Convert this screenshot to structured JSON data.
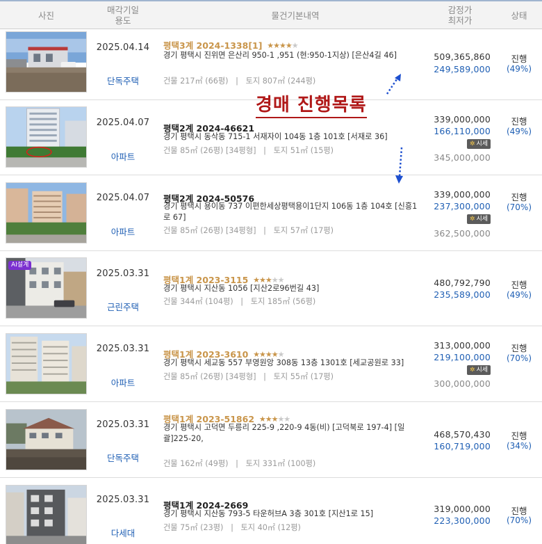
{
  "header": {
    "photo": "사진",
    "date_line1": "매각기일",
    "date_line2": "용도",
    "details": "물건기본내역",
    "price_line1": "감정가",
    "price_line2": "최저가",
    "status": "상태"
  },
  "overlay": {
    "title": "경매 진행목록"
  },
  "market_badge": "시세",
  "rows": [
    {
      "date": "2025.04.14",
      "type": "단독주택",
      "case": "평택3계 2024-1338[1]",
      "case_highlight": true,
      "stars": 4,
      "address": "경기 평택시 진위면 은산리 950-1 ,951 (현:950-1지상) [은산4길 46]",
      "building": "건물 217㎡ (66평)",
      "land": "토지 807㎡ (244평)",
      "appraisal": "509,365,860",
      "minimum": "249,589,000",
      "market": "",
      "status": "진행",
      "ratio": "(49%)",
      "ai_badge": ""
    },
    {
      "date": "2025.04.07",
      "type": "아파트",
      "case": "평택2계 2024-46621",
      "case_highlight": false,
      "stars": 0,
      "address": "경기 평택시 동삭동 715-1 서재자이 104동 1층 101호 [서재로 36]",
      "building": "건물 85㎡ (26평) [34평형]",
      "land": "토지 51㎡ (15평)",
      "appraisal": "339,000,000",
      "minimum": "166,110,000",
      "market": "345,000,000",
      "status": "진행",
      "ratio": "(49%)",
      "ai_badge": ""
    },
    {
      "date": "2025.04.07",
      "type": "아파트",
      "case": "평택2계 2024-50576",
      "case_highlight": false,
      "stars": 0,
      "address": "경기 평택시 용이동 737 이편한세상평택용이1단지 106동 1층 104호 [신흥1로 67]",
      "building": "건물 85㎡ (26평) [34평형]",
      "land": "토지 57㎡ (17평)",
      "appraisal": "339,000,000",
      "minimum": "237,300,000",
      "market": "362,500,000",
      "status": "진행",
      "ratio": "(70%)",
      "ai_badge": ""
    },
    {
      "date": "2025.03.31",
      "type": "근린주택",
      "case": "평택1계 2023-3115",
      "case_highlight": true,
      "stars": 3,
      "address": "경기 평택시 지산동 1056 [지산2로96번길 43]",
      "building": "건물 344㎡ (104평)",
      "land": "토지 185㎡ (56평)",
      "appraisal": "480,792,790",
      "minimum": "235,589,000",
      "market": "",
      "status": "진행",
      "ratio": "(49%)",
      "ai_badge": "AI설계"
    },
    {
      "date": "2025.03.31",
      "type": "아파트",
      "case": "평택1계 2023-3610",
      "case_highlight": true,
      "stars": 4,
      "address": "경기 평택시 세교동 557 부영원앙 308동 13층 1301호 [세교공원로 33]",
      "building": "건물 85㎡ (26평) [34평형]",
      "land": "토지 55㎡ (17평)",
      "appraisal": "313,000,000",
      "minimum": "219,100,000",
      "market": "300,000,000",
      "status": "진행",
      "ratio": "(70%)",
      "ai_badge": ""
    },
    {
      "date": "2025.03.31",
      "type": "단독주택",
      "case": "평택1계 2023-51862",
      "case_highlight": true,
      "stars": 3,
      "address": "경기 평택시 고덕면 두릉리 225-9 ,220-9 4동(비) [고덕북로 197-4] [일괄]225-20,",
      "building": "건물 162㎡ (49평)",
      "land": "토지 331㎡ (100평)",
      "appraisal": "468,570,430",
      "minimum": "160,719,000",
      "market": "",
      "status": "진행",
      "ratio": "(34%)",
      "ai_badge": ""
    },
    {
      "date": "2025.03.31",
      "type": "다세대",
      "case": "평택1계 2024-2669",
      "case_highlight": false,
      "stars": 0,
      "address": "경기 평택시 지산동 793-5 타운허브A 3층 301호 [지산1로 15]",
      "building": "건물 75㎡ (23평)",
      "land": "토지 40㎡ (12평)",
      "appraisal": "319,000,000",
      "minimum": "223,300,000",
      "market": "",
      "status": "진행",
      "ratio": "(70%)",
      "ai_badge": ""
    }
  ]
}
